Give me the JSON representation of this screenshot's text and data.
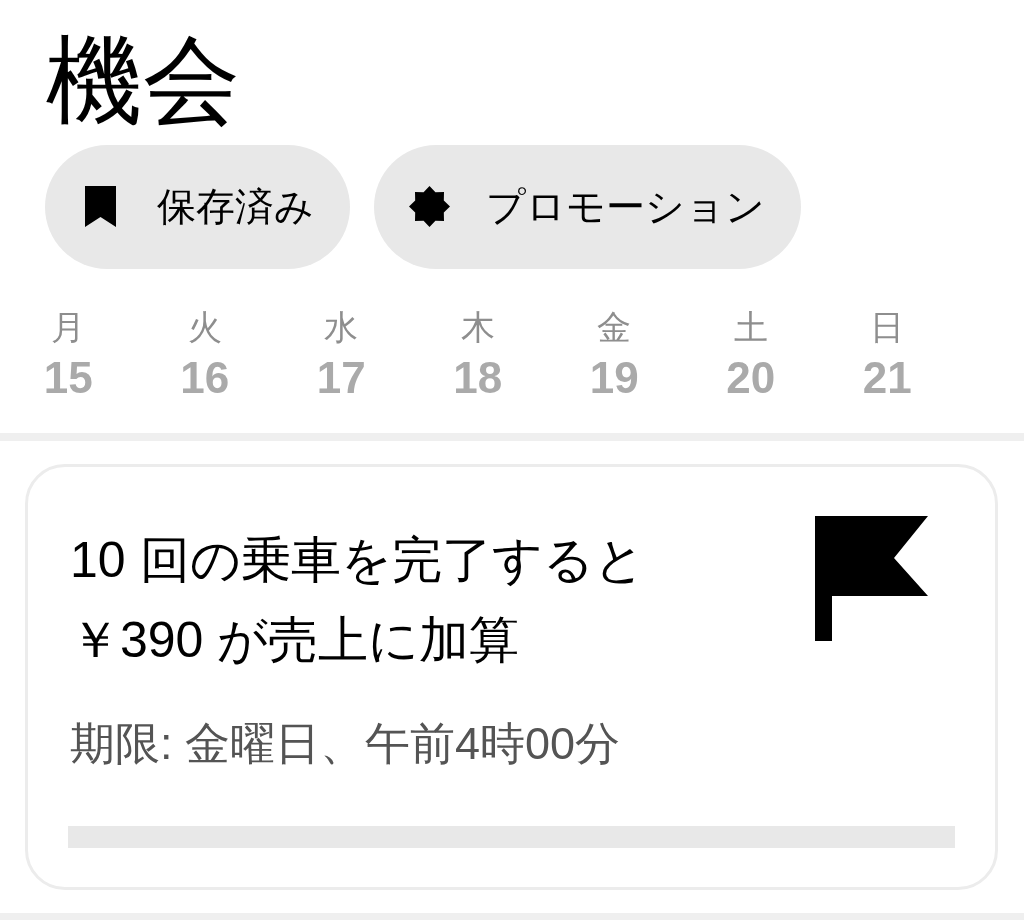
{
  "page": {
    "title": "機会"
  },
  "filters": [
    {
      "kind": "saved",
      "label": "保存済み"
    },
    {
      "kind": "promotion",
      "label": "プロモーション"
    }
  ],
  "days": [
    {
      "weekday": "月",
      "date": "15",
      "selected": false
    },
    {
      "weekday": "火",
      "date": "16",
      "selected": false
    },
    {
      "weekday": "水",
      "date": "17",
      "selected": false
    },
    {
      "weekday": "木",
      "date": "18",
      "selected": false
    },
    {
      "weekday": "金",
      "date": "19",
      "selected": false
    },
    {
      "weekday": "土",
      "date": "20",
      "selected": false
    },
    {
      "weekday": "日",
      "date": "21",
      "selected": false
    }
  ],
  "offer_card": {
    "title_lines": [
      "10 回の乗車を完了すると",
      "￥390 が売上に加算"
    ],
    "expiry": "期限: 金曜日、午前4時00分"
  }
}
